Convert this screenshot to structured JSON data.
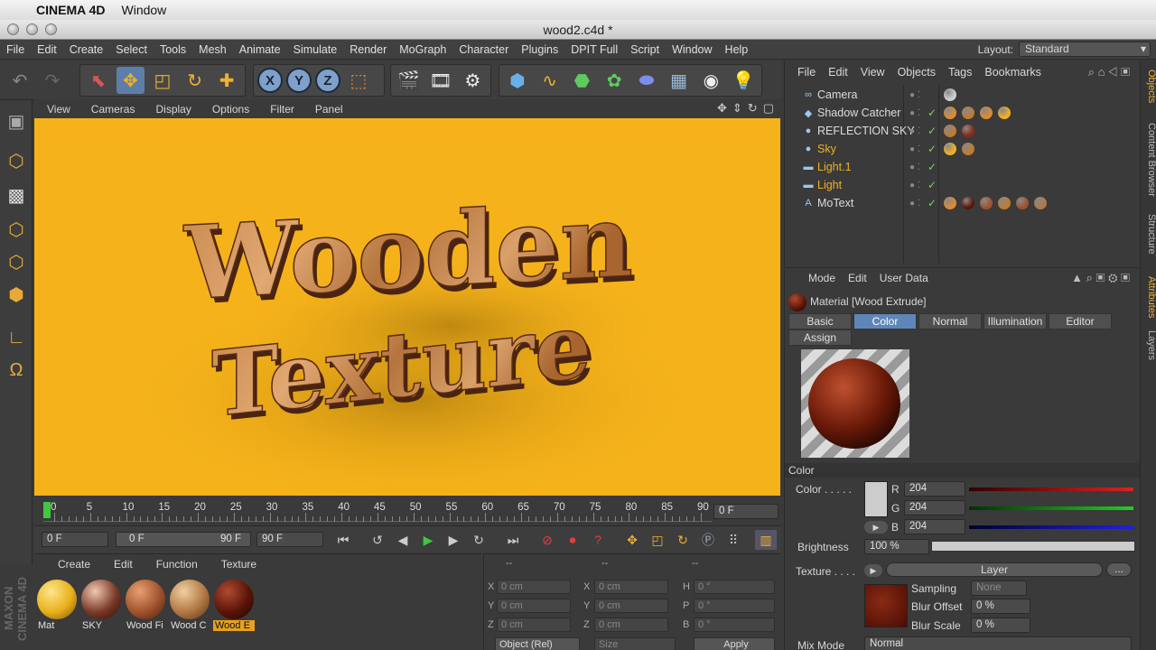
{
  "macbar": {
    "app": "CINEMA 4D",
    "menu": "Window"
  },
  "window": {
    "title": "wood2.c4d *"
  },
  "mainmenu": [
    "File",
    "Edit",
    "Create",
    "Select",
    "Tools",
    "Mesh",
    "Animate",
    "Simulate",
    "Render",
    "MoGraph",
    "Character",
    "Plugins",
    "DPIT Full",
    "Script",
    "Window",
    "Help"
  ],
  "layout": {
    "label": "Layout:",
    "value": "Standard"
  },
  "viewport": {
    "menu": [
      "View",
      "Cameras",
      "Display",
      "Options",
      "Filter",
      "Panel"
    ],
    "text_line1": "Wooden",
    "text_line2": "Texture",
    "bg_color": "#f5b21a"
  },
  "timeline": {
    "ticks": [
      "0",
      "5",
      "10",
      "15",
      "20",
      "25",
      "30",
      "35",
      "40",
      "45",
      "50",
      "55",
      "60",
      "65",
      "70",
      "75",
      "80",
      "85",
      "90"
    ],
    "current_frame": "0 F"
  },
  "playback": {
    "start": "0 F",
    "range_start": "0 F",
    "range_end": "90 F",
    "end": "90 F"
  },
  "materials": {
    "menu": [
      "Create",
      "Edit",
      "Function",
      "Texture"
    ],
    "items": [
      {
        "label": "Mat",
        "color": "#e8b01c"
      },
      {
        "label": "SKY",
        "color": "#7a3a28"
      },
      {
        "label": "Wood Fi",
        "color": "#a0522d"
      },
      {
        "label": "Wood C",
        "color": "#b07844"
      },
      {
        "label": "Wood E",
        "color": "#5a1408"
      }
    ]
  },
  "coordinates": {
    "header": [
      "--",
      "--",
      "--"
    ],
    "rows": [
      {
        "a": "X",
        "av": "0 cm",
        "b": "X",
        "bv": "0 cm",
        "c": "H",
        "cv": "0 °"
      },
      {
        "a": "Y",
        "av": "0 cm",
        "b": "Y",
        "bv": "0 cm",
        "c": "P",
        "cv": "0 °"
      },
      {
        "a": "Z",
        "av": "0 cm",
        "b": "Z",
        "bv": "0 cm",
        "c": "B",
        "cv": "0 °"
      }
    ],
    "mode": "Object (Rel)",
    "size": "Size",
    "apply": "Apply"
  },
  "objects": {
    "menu": [
      "File",
      "Edit",
      "View",
      "Objects",
      "Tags",
      "Bookmarks"
    ],
    "items": [
      {
        "name": "Camera",
        "icon": "camera-icon",
        "glyph": "∞",
        "color": "#dcdcdc"
      },
      {
        "name": "Shadow Catcher",
        "icon": "floor-icon",
        "glyph": "◆",
        "color": "#dcdcdc"
      },
      {
        "name": "REFLECTION SKY",
        "icon": "sky-icon",
        "glyph": "●",
        "color": "#dcdcdc"
      },
      {
        "name": "Sky",
        "icon": "sky-icon",
        "glyph": "●",
        "color": "#f0b020"
      },
      {
        "name": "Light.1",
        "icon": "light-icon",
        "glyph": "▬",
        "color": "#f0b020"
      },
      {
        "name": "Light",
        "icon": "light-icon",
        "glyph": "▬",
        "color": "#f0b020"
      },
      {
        "name": "MoText",
        "icon": "motext-icon",
        "glyph": "A",
        "color": "#dcdcdc"
      }
    ]
  },
  "attributes": {
    "menu": [
      "Mode",
      "Edit",
      "User Data"
    ],
    "title": "Material [Wood Extrude]",
    "tabs": [
      "Basic",
      "Color",
      "Normal",
      "Illumination",
      "Editor",
      "Assign"
    ],
    "section": "Color",
    "color_label": "Color . . . . .",
    "r_label": "R",
    "r": "204",
    "g_label": "G",
    "g": "204",
    "b_label": "B",
    "b": "204",
    "brightness_label": "Brightness",
    "brightness": "100 %",
    "texture_label": "Texture . . . .",
    "layer": "Layer",
    "more": "...",
    "sampling_label": "Sampling",
    "sampling": "None",
    "blur_offset_label": "Blur Offset",
    "blur_offset": "0 %",
    "blur_scale_label": "Blur Scale",
    "blur_scale": "0 %",
    "mix_mode_label": "Mix Mode",
    "mix_mode": "Normal"
  },
  "sidetabs": [
    "Objects",
    "Content Browser",
    "Structure",
    "Attributes",
    "Layers"
  ],
  "brand": "MAXON CINEMA 4D"
}
